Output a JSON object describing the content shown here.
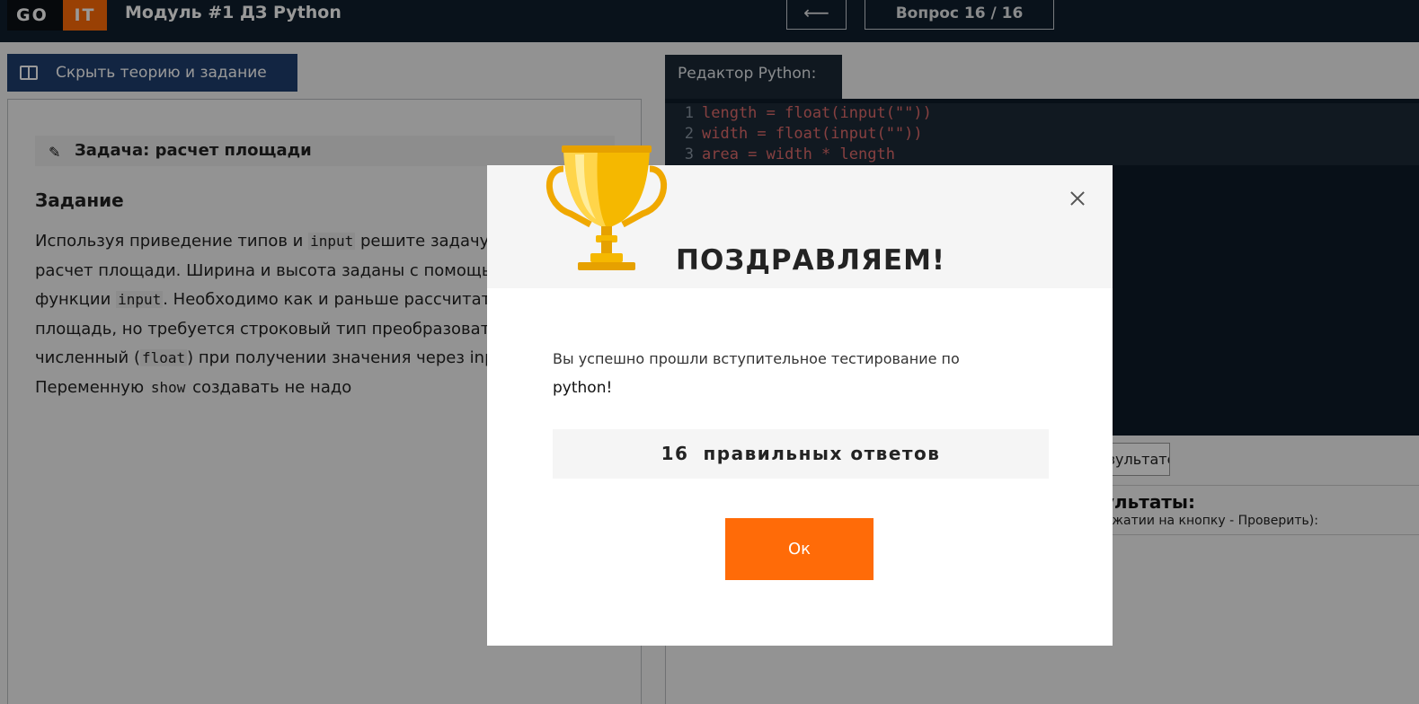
{
  "header": {
    "logo_go": "GO",
    "logo_it": "IT",
    "module_title": "Модуль #1 ДЗ Python",
    "back_arrow": "⟵",
    "question_counter": "Вопрос 16 / 16"
  },
  "left_panel": {
    "hide_button": "Скрыть теорию и задание",
    "task_title": "Задача: расчет площади",
    "section_title": "Задание",
    "description_lines": [
      [
        "Используя приведение типов и ",
        "input",
        " решите задачу на"
      ],
      [
        "расчет площади. Ширина и высота заданы с помощью"
      ],
      [
        "функции ",
        "input",
        ". Необходимо как и раньше рассчитать"
      ],
      [
        "площадь, но требуется строковый тип преобразовать в"
      ],
      [
        "численный (",
        "float",
        ") при получении значения через input."
      ],
      [
        "Переменную ",
        "show",
        " создавать не надо"
      ]
    ]
  },
  "editor": {
    "tab_label": "Редактор Python:",
    "lines": [
      {
        "num": "1",
        "code": "length = float(input(\"\"))"
      },
      {
        "num": "2",
        "code": "width = float(input(\"\"))"
      },
      {
        "num": "3",
        "code": "area = width * length"
      }
    ]
  },
  "results": {
    "button_label": "Результатов",
    "title": "Результаты:",
    "hint": "(при нажатии на кнопку - Проверить):"
  },
  "modal": {
    "title": "ПОЗДРАВЛЯЕМ!",
    "message": "Вы успешно прошли вступительное тестирование по",
    "course": "python!",
    "score_number": "16",
    "score_label": "правильных ответов",
    "ok_label": "Ок"
  },
  "colors": {
    "header_bg": "#0f1f2e",
    "accent_orange": "#ff6b08",
    "hide_button_bg": "#1f3f6e",
    "editor_bg": "#0e1b28",
    "code_red": "#e06c6c",
    "trophy_gold": "#f5b800"
  },
  "icons": {
    "close": "close-icon",
    "trophy": "trophy-icon",
    "pencil": "pencil-icon",
    "book": "book-icon",
    "back": "arrow-left-icon"
  }
}
